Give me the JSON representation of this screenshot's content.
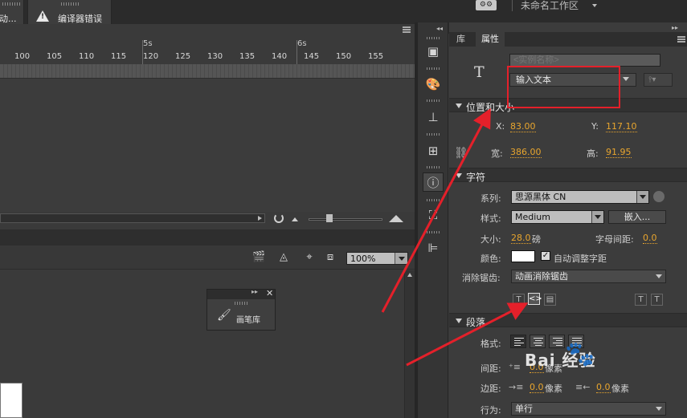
{
  "top_tabs": [
    {
      "label": "动..."
    },
    {
      "label": "编译器错误"
    }
  ],
  "workspace": {
    "label": "未命名工作区",
    "icon": "gear-icon"
  },
  "timeline": {
    "seconds": [
      "5s",
      "6s"
    ],
    "frames": [
      "100",
      "105",
      "110",
      "115",
      "120",
      "125",
      "130",
      "135",
      "140",
      "145",
      "150",
      "155"
    ]
  },
  "stage": {
    "zoom": "100%"
  },
  "brush_library": {
    "label": "画笔库"
  },
  "panel_tabs": {
    "library": "库",
    "properties": "属性"
  },
  "properties": {
    "instance_name_placeholder": "<实例名称>",
    "text_type": "输入文本",
    "position_section": "位置和大小",
    "x_label": "X:",
    "x": "83.00",
    "y_label": "Y:",
    "y": "117.10",
    "w_label": "宽:",
    "w": "386.00",
    "h_label": "高:",
    "h": "91.95",
    "char_section": "字符",
    "family_label": "系列:",
    "family": "思源黑体 CN",
    "style_label": "样式:",
    "style": "Medium",
    "embed_button": "嵌入...",
    "size_label": "大小:",
    "size": "28.0",
    "size_unit": "磅",
    "spacing_label": "字母间距:",
    "spacing": "0.0",
    "color_label": "颜色:",
    "auto_kern_label": "自动调整字距",
    "auto_kern_checked": true,
    "aa_label": "消除锯齿:",
    "aa": "动画消除锯齿",
    "para_section": "段落",
    "format_label": "格式:",
    "indent_label": "间距:",
    "indent": "0.0",
    "indent_unit": "像素",
    "margin_label": "边距:",
    "margin_left": "0.0",
    "margin_unit": "像素",
    "margin_right": "0.0",
    "margin_right_unit": "像素",
    "behavior_label": "行为:",
    "behavior": "单行"
  },
  "annotation_color": "#e4202a",
  "watermark": "Bai 经验"
}
